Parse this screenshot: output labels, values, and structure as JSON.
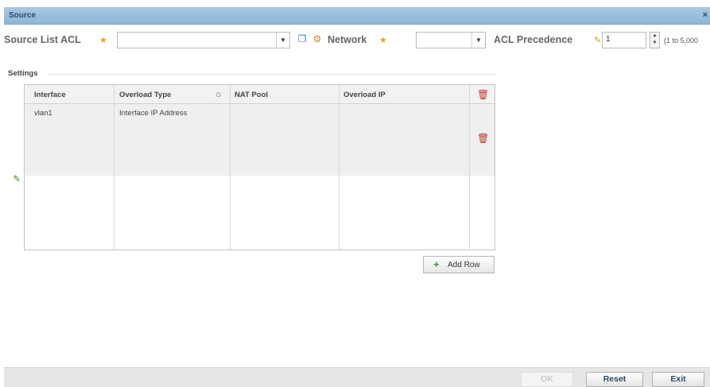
{
  "dialog": {
    "title": "Source",
    "close_glyph": "×"
  },
  "toolbar": {
    "source_acl_label": "Source List ACL",
    "source_acl_value": "",
    "network_label": "Network",
    "network_value": "",
    "precedence_label": "ACL Precedence",
    "precedence_value": "1",
    "precedence_range": "(1 to 5,000"
  },
  "settings": {
    "label": "Settings",
    "columns": [
      "Interface",
      "Overload Type",
      "NAT Pool",
      "Overload IP"
    ],
    "rows": [
      {
        "interface": "vlan1",
        "overload_type": "Interface IP Address",
        "nat_pool": "",
        "overload_ip": ""
      }
    ],
    "add_row_label": "Add Row"
  },
  "footer": {
    "ok_label": "OK",
    "reset_label": "Reset",
    "exit_label": "Exit"
  },
  "colors": {
    "title_bar": "#9dc1de",
    "required_star": "#f0a020",
    "delete_icon": "#c0392b",
    "add_icon": "#2f9e2f"
  },
  "icons": [
    "close-icon",
    "required-star-icon",
    "dropdown-arrow-icon",
    "create-icon",
    "edit-gear-icon",
    "spin-up-icon",
    "spin-down-icon",
    "sort-icon",
    "trash-icon",
    "pencil-icon",
    "plus-icon"
  ]
}
